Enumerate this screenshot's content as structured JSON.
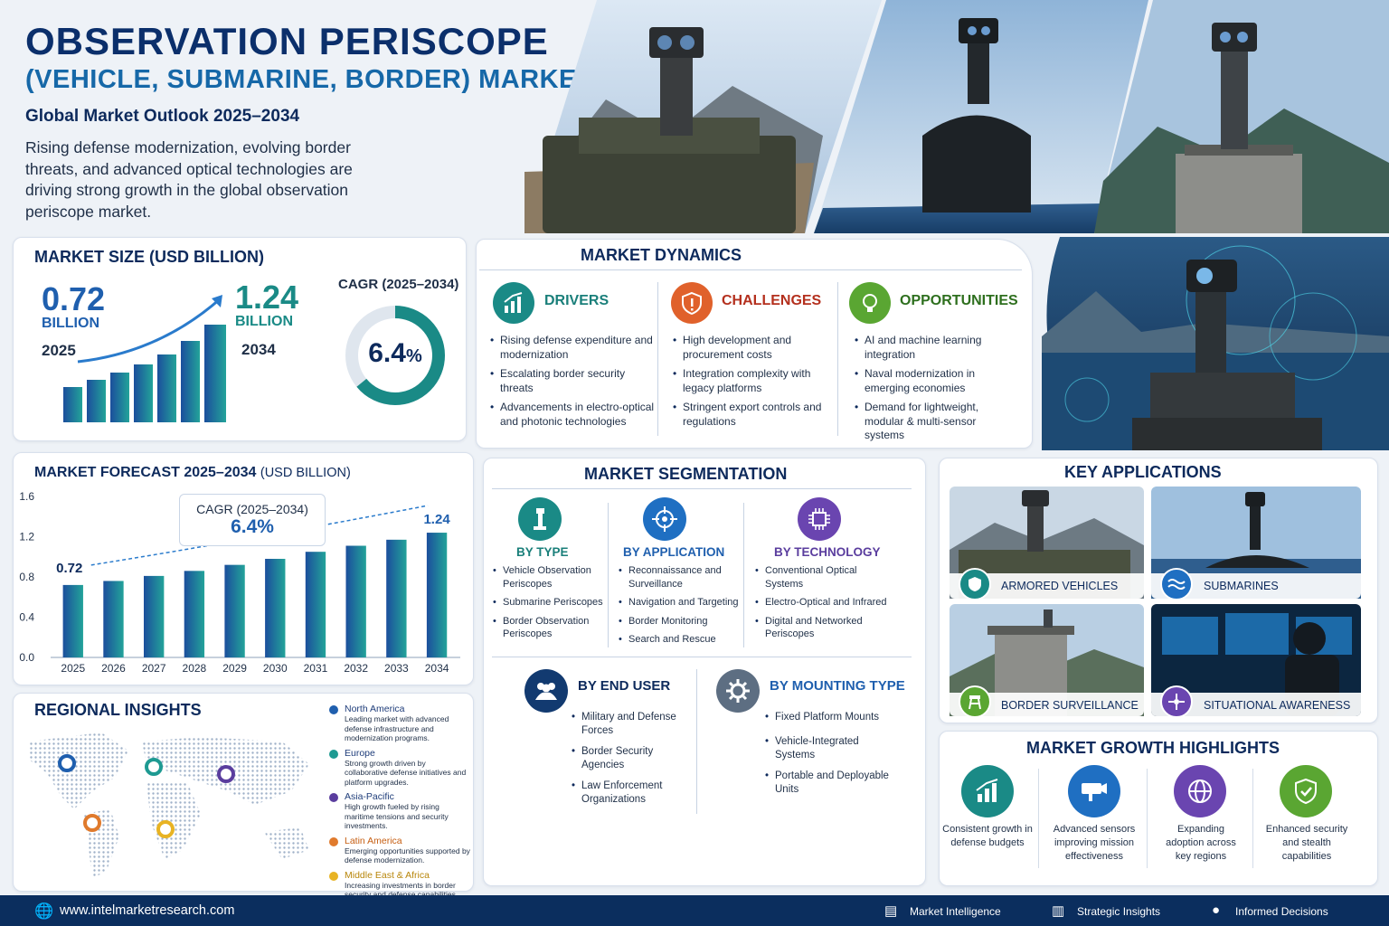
{
  "header": {
    "title_line1": "OBSERVATION PERISCOPE",
    "title_line2": "(VEHICLE, SUBMARINE, BORDER) MARKET",
    "subtitle": "Global Market Outlook 2025–2034",
    "intro": "Rising defense modernization, evolving border threats, and advanced optical technologies are driving strong growth in the global observation periscope market."
  },
  "market_size": {
    "title": "MARKET SIZE (USD BILLION)",
    "start_value": "0.72",
    "start_unit": "BILLION",
    "start_year": "2025",
    "end_value": "1.24",
    "end_unit": "BILLION",
    "end_year": "2034",
    "cagr_label": "CAGR (2025–2034)",
    "cagr_value": "6.4",
    "cagr_pct": "%",
    "ring_fill_pct": 64
  },
  "dynamics": {
    "title": "MARKET DYNAMICS",
    "drivers": {
      "title": "DRIVERS",
      "items": [
        "Rising defense expenditure and modernization",
        "Escalating border security threats",
        "Advancements in electro-optical and photonic technologies"
      ]
    },
    "challenges": {
      "title": "CHALLENGES",
      "items": [
        "High development and procurement costs",
        "Integration complexity with legacy platforms",
        "Stringent export controls and regulations"
      ]
    },
    "opportunities": {
      "title": "OPPORTUNITIES",
      "items": [
        "AI and machine learning integration",
        "Naval modernization in emerging economies",
        "Demand for lightweight, modular & multi-sensor systems"
      ]
    }
  },
  "forecast": {
    "title": "MARKET FORECAST 2025–2034",
    "title_unit": "(USD BILLION)",
    "cagr_label": "CAGR (2025–2034)",
    "cagr_value": "6.4%",
    "first_label": "0.72",
    "last_label": "1.24"
  },
  "chart_data": {
    "type": "bar",
    "title": "MARKET FORECAST 2025–2034 (USD BILLION)",
    "categories": [
      "2025",
      "2026",
      "2027",
      "2028",
      "2029",
      "2030",
      "2031",
      "2032",
      "2033",
      "2034"
    ],
    "values": [
      0.72,
      0.76,
      0.81,
      0.86,
      0.92,
      0.98,
      1.05,
      1.11,
      1.17,
      1.24
    ],
    "yticks": [
      "0.0",
      "0.4",
      "0.8",
      "1.2",
      "1.6"
    ],
    "ylim": [
      0,
      1.6
    ],
    "grid": false
  },
  "segmentation": {
    "title": "MARKET SEGMENTATION",
    "by_type": {
      "title": "BY TYPE",
      "items": [
        "Vehicle Observation Periscopes",
        "Submarine Periscopes",
        "Border Observation Periscopes"
      ]
    },
    "by_application": {
      "title": "BY APPLICATION",
      "items": [
        "Reconnaissance and Surveillance",
        "Navigation and Targeting",
        "Border Monitoring",
        "Search and Rescue"
      ]
    },
    "by_technology": {
      "title": "BY TECHNOLOGY",
      "items": [
        "Conventional Optical Systems",
        "Electro-Optical and Infrared",
        "Digital and Networked Periscopes"
      ]
    },
    "by_end_user": {
      "title": "BY END USER",
      "items": [
        "Military and Defense Forces",
        "Border Security Agencies",
        "Law Enforcement Organizations"
      ]
    },
    "by_mounting": {
      "title": "BY MOUNTING TYPE",
      "items": [
        "Fixed Platform Mounts",
        "Vehicle-Integrated Systems",
        "Portable and Deployable Units"
      ]
    }
  },
  "applications": {
    "title": "KEY APPLICATIONS",
    "items": [
      "ARMORED VEHICLES",
      "SUBMARINES",
      "BORDER SURVEILLANCE",
      "SITUATIONAL AWARENESS"
    ]
  },
  "regional": {
    "title": "REGIONAL INSIGHTS",
    "regions": [
      {
        "name": "North America",
        "desc": "Leading market with advanced defense infrastructure and modernization programs.",
        "color": "#1f5fae"
      },
      {
        "name": "Europe",
        "desc": "Strong growth driven by collaborative defense initiatives and platform upgrades.",
        "color": "#1e9a92"
      },
      {
        "name": "Asia-Pacific",
        "desc": "High growth fueled by rising maritime tensions and security investments.",
        "color": "#5a3d9e"
      },
      {
        "name": "Latin America",
        "desc": "Emerging opportunities supported by defense modernization.",
        "color": "#e07a2c"
      },
      {
        "name": "Middle East & Africa",
        "desc": "Increasing investments in border security and defense capabilities.",
        "color": "#e8b323"
      }
    ]
  },
  "highlights": {
    "title": "MARKET GROWTH HIGHLIGHTS",
    "items": [
      "Consistent growth in defense budgets",
      "Advanced sensors improving mission effectiveness",
      "Expanding adoption across key regions",
      "Enhanced security and stealth capabilities"
    ]
  },
  "footer": {
    "website": "www.intelmarketresearch.com",
    "tags": [
      "Market Intelligence",
      "Strategic Insights",
      "Informed Decisions"
    ]
  }
}
